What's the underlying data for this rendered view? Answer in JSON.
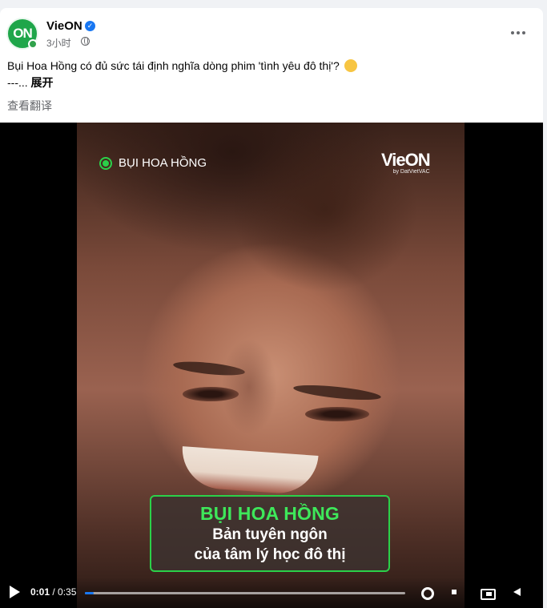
{
  "post": {
    "page_name": "VieON",
    "avatar_text": "ON",
    "time": "3小时",
    "caption_text": "Bụi Hoa Hồng có đủ sức tái định nghĩa dòng phim 'tình yêu đô thị'?",
    "caption_more_prefix": "---...",
    "expand_label": "展开",
    "translate_label": "查看翻译",
    "emoji_icon": "thinking-face-icon",
    "verified_icon": "verified-badge-icon",
    "privacy_icon": "globe-icon"
  },
  "video": {
    "overlay_tag": "BỤI HOA HỒNG",
    "watermark_logo": "VieON",
    "watermark_sub": "by DatVietVAC",
    "subtitle_title": "BỤI HOA HỒNG",
    "subtitle_line1": "Bản tuyên ngôn",
    "subtitle_line2": "của tâm lý học đô thị",
    "current_time": "0:01",
    "separator": " / ",
    "total_time": "0:35",
    "progress_fraction": 0.028,
    "accent_color": "#2bd149",
    "progress_color": "#1877f2"
  }
}
